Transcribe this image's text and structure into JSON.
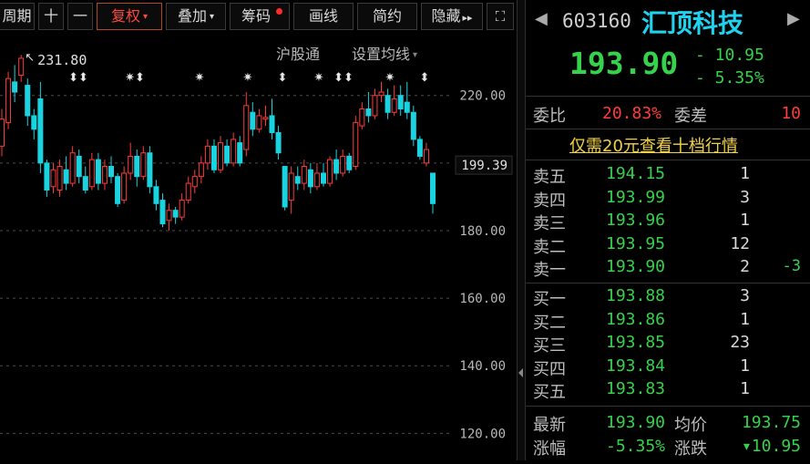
{
  "toolbar": {
    "period": "周期",
    "plus": "十",
    "minus": "一",
    "fq": "复权",
    "overlay": "叠加",
    "chips": "筹码",
    "draw": "画线",
    "simple": "简约",
    "hide": "隐藏",
    "hide_arrows": "▸▸",
    "fullscreen_glyph": "⛶",
    "fq_caret": "▾",
    "overlay_caret": "▾"
  },
  "chart_header": {
    "hgt": "沪股通",
    "ma_setting": "设置均线",
    "ma_caret": "▾"
  },
  "chart_data": {
    "type": "candlestick",
    "y_ticks": [
      "220.00",
      "200.00",
      "180.00",
      "160.00",
      "140.00",
      "120.00"
    ],
    "ylim": [
      112,
      238
    ],
    "last_price_label": "199.39",
    "last_price": 199.39,
    "high_label": "231.80",
    "high_marker": "↖",
    "grid": true,
    "candles": [
      {
        "o": 205,
        "c": 213,
        "h": 216,
        "l": 202
      },
      {
        "o": 212,
        "c": 225,
        "h": 227,
        "l": 210
      },
      {
        "o": 224,
        "c": 221,
        "h": 229,
        "l": 218
      },
      {
        "o": 226,
        "c": 231,
        "h": 232,
        "l": 224
      },
      {
        "o": 223,
        "c": 214,
        "h": 225,
        "l": 211
      },
      {
        "o": 214,
        "c": 210,
        "h": 216,
        "l": 207
      },
      {
        "o": 219,
        "c": 200,
        "h": 224,
        "l": 197
      },
      {
        "o": 200,
        "c": 192,
        "h": 201,
        "l": 190
      },
      {
        "o": 193,
        "c": 198,
        "h": 200,
        "l": 191
      },
      {
        "o": 192,
        "c": 199,
        "h": 201,
        "l": 190
      },
      {
        "o": 198,
        "c": 194,
        "h": 202,
        "l": 192
      },
      {
        "o": 194,
        "c": 203,
        "h": 205,
        "l": 193
      },
      {
        "o": 202,
        "c": 196,
        "h": 204,
        "l": 194
      },
      {
        "o": 196,
        "c": 192,
        "h": 199,
        "l": 191
      },
      {
        "o": 193,
        "c": 201,
        "h": 203,
        "l": 192
      },
      {
        "o": 201,
        "c": 194,
        "h": 203,
        "l": 192
      },
      {
        "o": 194,
        "c": 199,
        "h": 201,
        "l": 192
      },
      {
        "o": 199,
        "c": 196,
        "h": 202,
        "l": 194
      },
      {
        "o": 196,
        "c": 188,
        "h": 197,
        "l": 187
      },
      {
        "o": 189,
        "c": 197,
        "h": 199,
        "l": 188
      },
      {
        "o": 197,
        "c": 202,
        "h": 206,
        "l": 195
      },
      {
        "o": 202,
        "c": 196,
        "h": 204,
        "l": 193
      },
      {
        "o": 196,
        "c": 203,
        "h": 205,
        "l": 195
      },
      {
        "o": 203,
        "c": 193,
        "h": 205,
        "l": 191
      },
      {
        "o": 193,
        "c": 188,
        "h": 195,
        "l": 186
      },
      {
        "o": 189,
        "c": 182,
        "h": 191,
        "l": 181
      },
      {
        "o": 183,
        "c": 186,
        "h": 188,
        "l": 180
      },
      {
        "o": 186,
        "c": 184,
        "h": 187,
        "l": 182
      },
      {
        "o": 184,
        "c": 189,
        "h": 191,
        "l": 183
      },
      {
        "o": 189,
        "c": 194,
        "h": 196,
        "l": 188
      },
      {
        "o": 193,
        "c": 196,
        "h": 198,
        "l": 191
      },
      {
        "o": 196,
        "c": 200,
        "h": 202,
        "l": 194
      },
      {
        "o": 200,
        "c": 205,
        "h": 207,
        "l": 198
      },
      {
        "o": 205,
        "c": 198,
        "h": 207,
        "l": 197
      },
      {
        "o": 198,
        "c": 206,
        "h": 208,
        "l": 197
      },
      {
        "o": 205,
        "c": 200,
        "h": 207,
        "l": 199
      },
      {
        "o": 200,
        "c": 207,
        "h": 209,
        "l": 199
      },
      {
        "o": 206,
        "c": 200,
        "h": 208,
        "l": 199
      },
      {
        "o": 204,
        "c": 217,
        "h": 221,
        "l": 202
      },
      {
        "o": 215,
        "c": 210,
        "h": 218,
        "l": 208
      },
      {
        "o": 210,
        "c": 214,
        "h": 216,
        "l": 209
      },
      {
        "o": 213,
        "c": 213.5,
        "h": 217,
        "l": 211
      },
      {
        "o": 214,
        "c": 209,
        "h": 219,
        "l": 207
      },
      {
        "o": 209,
        "c": 203,
        "h": 211,
        "l": 201
      },
      {
        "o": 199,
        "c": 187,
        "h": 199,
        "l": 186
      },
      {
        "o": 189,
        "c": 197,
        "h": 199,
        "l": 185
      },
      {
        "o": 196,
        "c": 194,
        "h": 199,
        "l": 192
      },
      {
        "o": 194,
        "c": 199,
        "h": 201,
        "l": 192
      },
      {
        "o": 198,
        "c": 193,
        "h": 200,
        "l": 191
      },
      {
        "o": 193,
        "c": 197,
        "h": 200,
        "l": 192
      },
      {
        "o": 197,
        "c": 194,
        "h": 200,
        "l": 193
      },
      {
        "o": 194,
        "c": 201,
        "h": 202,
        "l": 193
      },
      {
        "o": 201,
        "c": 197,
        "h": 204,
        "l": 195
      },
      {
        "o": 197,
        "c": 202,
        "h": 204,
        "l": 196
      },
      {
        "o": 202,
        "c": 198,
        "h": 203,
        "l": 197
      },
      {
        "o": 199,
        "c": 212,
        "h": 214,
        "l": 198
      },
      {
        "o": 211,
        "c": 216,
        "h": 218,
        "l": 210
      },
      {
        "o": 216,
        "c": 214,
        "h": 221,
        "l": 212
      },
      {
        "o": 214,
        "c": 220,
        "h": 222,
        "l": 213
      },
      {
        "o": 220,
        "c": 221,
        "h": 224,
        "l": 218
      },
      {
        "o": 220,
        "c": 215,
        "h": 222,
        "l": 213
      },
      {
        "o": 215,
        "c": 219,
        "h": 223,
        "l": 214
      },
      {
        "o": 220,
        "c": 216,
        "h": 223,
        "l": 214
      },
      {
        "o": 218,
        "c": 215,
        "h": 224,
        "l": 213
      },
      {
        "o": 215,
        "c": 207,
        "h": 217,
        "l": 205
      },
      {
        "o": 207,
        "c": 202,
        "h": 208,
        "l": 201
      },
      {
        "o": 200,
        "c": 204,
        "h": 206,
        "l": 199
      },
      {
        "o": 197,
        "c": 188,
        "h": 197,
        "l": 185
      }
    ],
    "event_markers": [
      "⬍⬍",
      "✷⬍",
      "✷",
      "✷",
      "⬍",
      "✷",
      "⬍⬍",
      "✷",
      "⬍"
    ]
  },
  "quote": {
    "code": "603160",
    "name": "汇顶科技",
    "price": "193.90",
    "change": "- 10.95",
    "change_pct": "- 5.35%",
    "prev_arrow": "◀",
    "next_arrow": "▶",
    "weibi_label": "委比",
    "weibi": "20.83%",
    "weicha_label": "委差",
    "weicha": "10",
    "promo": "仅需20元查看十档行情",
    "sell": [
      {
        "label": "卖五",
        "price": "194.15",
        "vol": "1",
        "chg": ""
      },
      {
        "label": "卖四",
        "price": "193.99",
        "vol": "3",
        "chg": ""
      },
      {
        "label": "卖三",
        "price": "193.96",
        "vol": "1",
        "chg": ""
      },
      {
        "label": "卖二",
        "price": "193.95",
        "vol": "12",
        "chg": ""
      },
      {
        "label": "卖一",
        "price": "193.90",
        "vol": "2",
        "chg": "-3"
      }
    ],
    "buy": [
      {
        "label": "买一",
        "price": "193.88",
        "vol": "3",
        "chg": ""
      },
      {
        "label": "买二",
        "price": "193.86",
        "vol": "1",
        "chg": ""
      },
      {
        "label": "买三",
        "price": "193.85",
        "vol": "23",
        "chg": ""
      },
      {
        "label": "买四",
        "price": "193.84",
        "vol": "1",
        "chg": ""
      },
      {
        "label": "买五",
        "price": "193.83",
        "vol": "1",
        "chg": ""
      }
    ],
    "last_label": "最新",
    "last": "193.90",
    "avg_label": "均价",
    "avg": "193.75",
    "pct_label": "涨幅",
    "pct": "-5.35%",
    "chg_label": "涨跌",
    "chg": "▾10.95"
  },
  "colors": {
    "up": "#ff3b3b",
    "down": "#19d4e0",
    "green": "#36d24b",
    "active_border": "#b34a1c"
  }
}
